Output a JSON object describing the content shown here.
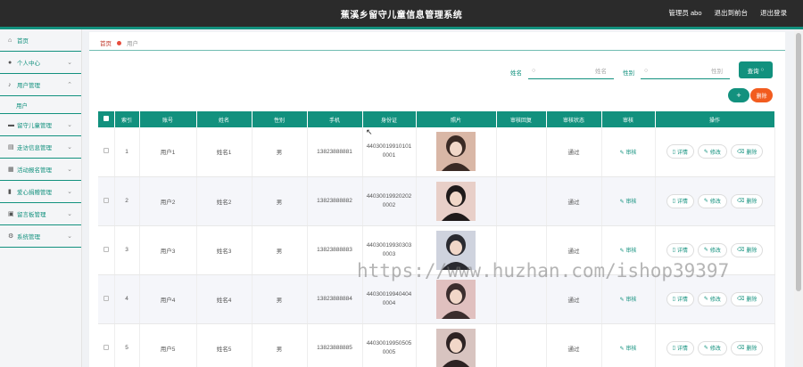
{
  "header": {
    "title": "蕉溪乡留守儿童信息管理系统",
    "admin": "管理员 abo",
    "back": "退出到前台",
    "logout": "退出登录"
  },
  "sidebar": {
    "items": [
      {
        "label": "首页",
        "icon": "home-icon"
      },
      {
        "label": "个人中心",
        "icon": "user-icon"
      },
      {
        "label": "用户管理",
        "icon": "mic-icon"
      },
      {
        "label": "用户",
        "icon": ""
      },
      {
        "label": "留守儿童管理",
        "icon": "monitor-icon"
      },
      {
        "label": "走访信息管理",
        "icon": "doc-icon"
      },
      {
        "label": "活动报名管理",
        "icon": "layout-icon"
      },
      {
        "label": "爱心捐赠管理",
        "icon": "chart-icon"
      },
      {
        "label": "留言板管理",
        "icon": "board-icon"
      },
      {
        "label": "系统管理",
        "icon": "settings-icon"
      }
    ]
  },
  "breadcrumb": {
    "home": "首页",
    "current": "用户"
  },
  "search": {
    "name_label": "姓名",
    "name_placeholder": "姓名",
    "gender_label": "性别",
    "gender_placeholder": "性别",
    "query": "查询"
  },
  "buttons": {
    "add": "+",
    "delete": "删除"
  },
  "table": {
    "headers": [
      "",
      "索引",
      "账号",
      "姓名",
      "性别",
      "手机",
      "身份证",
      "照片",
      "审核回复",
      "审核状态",
      "审核",
      "操作"
    ],
    "rows": [
      {
        "index": "1",
        "account": "用户1",
        "name": "姓名1",
        "gender": "男",
        "phone": "13823888881",
        "id_line1": "44030019910101",
        "id_line2": "0001",
        "reply": "",
        "status": "通过"
      },
      {
        "index": "2",
        "account": "用户2",
        "name": "姓名2",
        "gender": "男",
        "phone": "13823888882",
        "id_line1": "44030019920202",
        "id_line2": "0002",
        "reply": "",
        "status": "通过"
      },
      {
        "index": "3",
        "account": "用户3",
        "name": "姓名3",
        "gender": "男",
        "phone": "13823888883",
        "id_line1": "44030019930303",
        "id_line2": "0003",
        "reply": "",
        "status": "通过"
      },
      {
        "index": "4",
        "account": "用户4",
        "name": "姓名4",
        "gender": "男",
        "phone": "13823888884",
        "id_line1": "44030019940404",
        "id_line2": "0004",
        "reply": "",
        "status": "通过"
      },
      {
        "index": "5",
        "account": "用户5",
        "name": "姓名5",
        "gender": "男",
        "phone": "13823888885",
        "id_line1": "44030019950505",
        "id_line2": "0005",
        "reply": "",
        "status": "通过"
      }
    ],
    "audit_label": "审核",
    "ops": {
      "detail": "详情",
      "edit": "修改",
      "delete": "删除"
    }
  },
  "watermark": "https://www.huzhan.com/ishop39397",
  "colors": {
    "accent": "#12917e",
    "danger": "#f25c1f",
    "header": "#2b2b2b"
  }
}
